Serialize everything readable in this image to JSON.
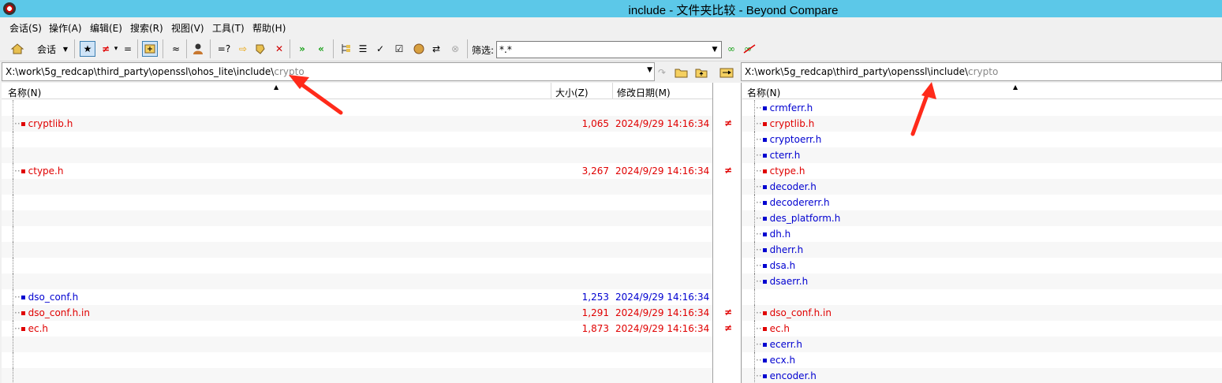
{
  "window": {
    "title": "include - 文件夹比较 - Beyond Compare"
  },
  "menu": [
    "会话(S)",
    "操作(A)",
    "编辑(E)",
    "搜索(R)",
    "视图(V)",
    "工具(T)",
    "帮助(H)"
  ],
  "toolbar": {
    "session_label": "会话",
    "filter_label": "筛选:",
    "filter_value": "*.*"
  },
  "left": {
    "path_main": "X:\\work\\5g_redcap\\third_party\\openssl\\ohos_lite\\include\\",
    "path_tail": "crypto",
    "columns": {
      "name": "名称(N)",
      "size": "大小(Z)",
      "date": "修改日期(M)"
    },
    "rows": [
      {
        "name": "",
        "size": "",
        "date": "",
        "color": ""
      },
      {
        "name": "cryptlib.h",
        "size": "1,065",
        "date": "2024/9/29 14:16:34",
        "color": "red"
      },
      {
        "name": "",
        "size": "",
        "date": "",
        "color": ""
      },
      {
        "name": "",
        "size": "",
        "date": "",
        "color": ""
      },
      {
        "name": "ctype.h",
        "size": "3,267",
        "date": "2024/9/29 14:16:34",
        "color": "red"
      },
      {
        "name": "",
        "size": "",
        "date": "",
        "color": ""
      },
      {
        "name": "",
        "size": "",
        "date": "",
        "color": ""
      },
      {
        "name": "",
        "size": "",
        "date": "",
        "color": ""
      },
      {
        "name": "",
        "size": "",
        "date": "",
        "color": ""
      },
      {
        "name": "",
        "size": "",
        "date": "",
        "color": ""
      },
      {
        "name": "",
        "size": "",
        "date": "",
        "color": ""
      },
      {
        "name": "",
        "size": "",
        "date": "",
        "color": ""
      },
      {
        "name": "dso_conf.h",
        "size": "1,253",
        "date": "2024/9/29 14:16:34",
        "color": "blue"
      },
      {
        "name": "dso_conf.h.in",
        "size": "1,291",
        "date": "2024/9/29 14:16:34",
        "color": "red"
      },
      {
        "name": "ec.h",
        "size": "1,873",
        "date": "2024/9/29 14:16:34",
        "color": "red"
      },
      {
        "name": "",
        "size": "",
        "date": "",
        "color": ""
      },
      {
        "name": "",
        "size": "",
        "date": "",
        "color": ""
      },
      {
        "name": "",
        "size": "",
        "date": "",
        "color": ""
      }
    ]
  },
  "right": {
    "path_main": "X:\\work\\5g_redcap\\third_party\\openssl\\include\\",
    "path_tail": "crypto",
    "columns": {
      "name": "名称(N)"
    },
    "rows": [
      {
        "name": "crmferr.h",
        "color": "blue"
      },
      {
        "name": "cryptlib.h",
        "color": "red"
      },
      {
        "name": "cryptoerr.h",
        "color": "blue"
      },
      {
        "name": "cterr.h",
        "color": "blue"
      },
      {
        "name": "ctype.h",
        "color": "red"
      },
      {
        "name": "decoder.h",
        "color": "blue"
      },
      {
        "name": "decodererr.h",
        "color": "blue"
      },
      {
        "name": "des_platform.h",
        "color": "blue"
      },
      {
        "name": "dh.h",
        "color": "blue"
      },
      {
        "name": "dherr.h",
        "color": "blue"
      },
      {
        "name": "dsa.h",
        "color": "blue"
      },
      {
        "name": "dsaerr.h",
        "color": "blue"
      },
      {
        "name": "",
        "color": ""
      },
      {
        "name": "dso_conf.h.in",
        "color": "red"
      },
      {
        "name": "ec.h",
        "color": "red"
      },
      {
        "name": "ecerr.h",
        "color": "blue"
      },
      {
        "name": "ecx.h",
        "color": "blue"
      },
      {
        "name": "encoder.h",
        "color": "blue"
      }
    ]
  },
  "gutter": [
    "",
    "≠",
    "",
    "",
    "≠",
    "",
    "",
    "",
    "",
    "",
    "",
    "",
    "",
    "≠",
    "≠",
    "",
    "",
    ""
  ],
  "colors": {
    "titlebar": "#5cc8e8",
    "diff": "#e00000",
    "orphan": "#0000d0",
    "annotation_arrow": "#ff2a1a"
  }
}
